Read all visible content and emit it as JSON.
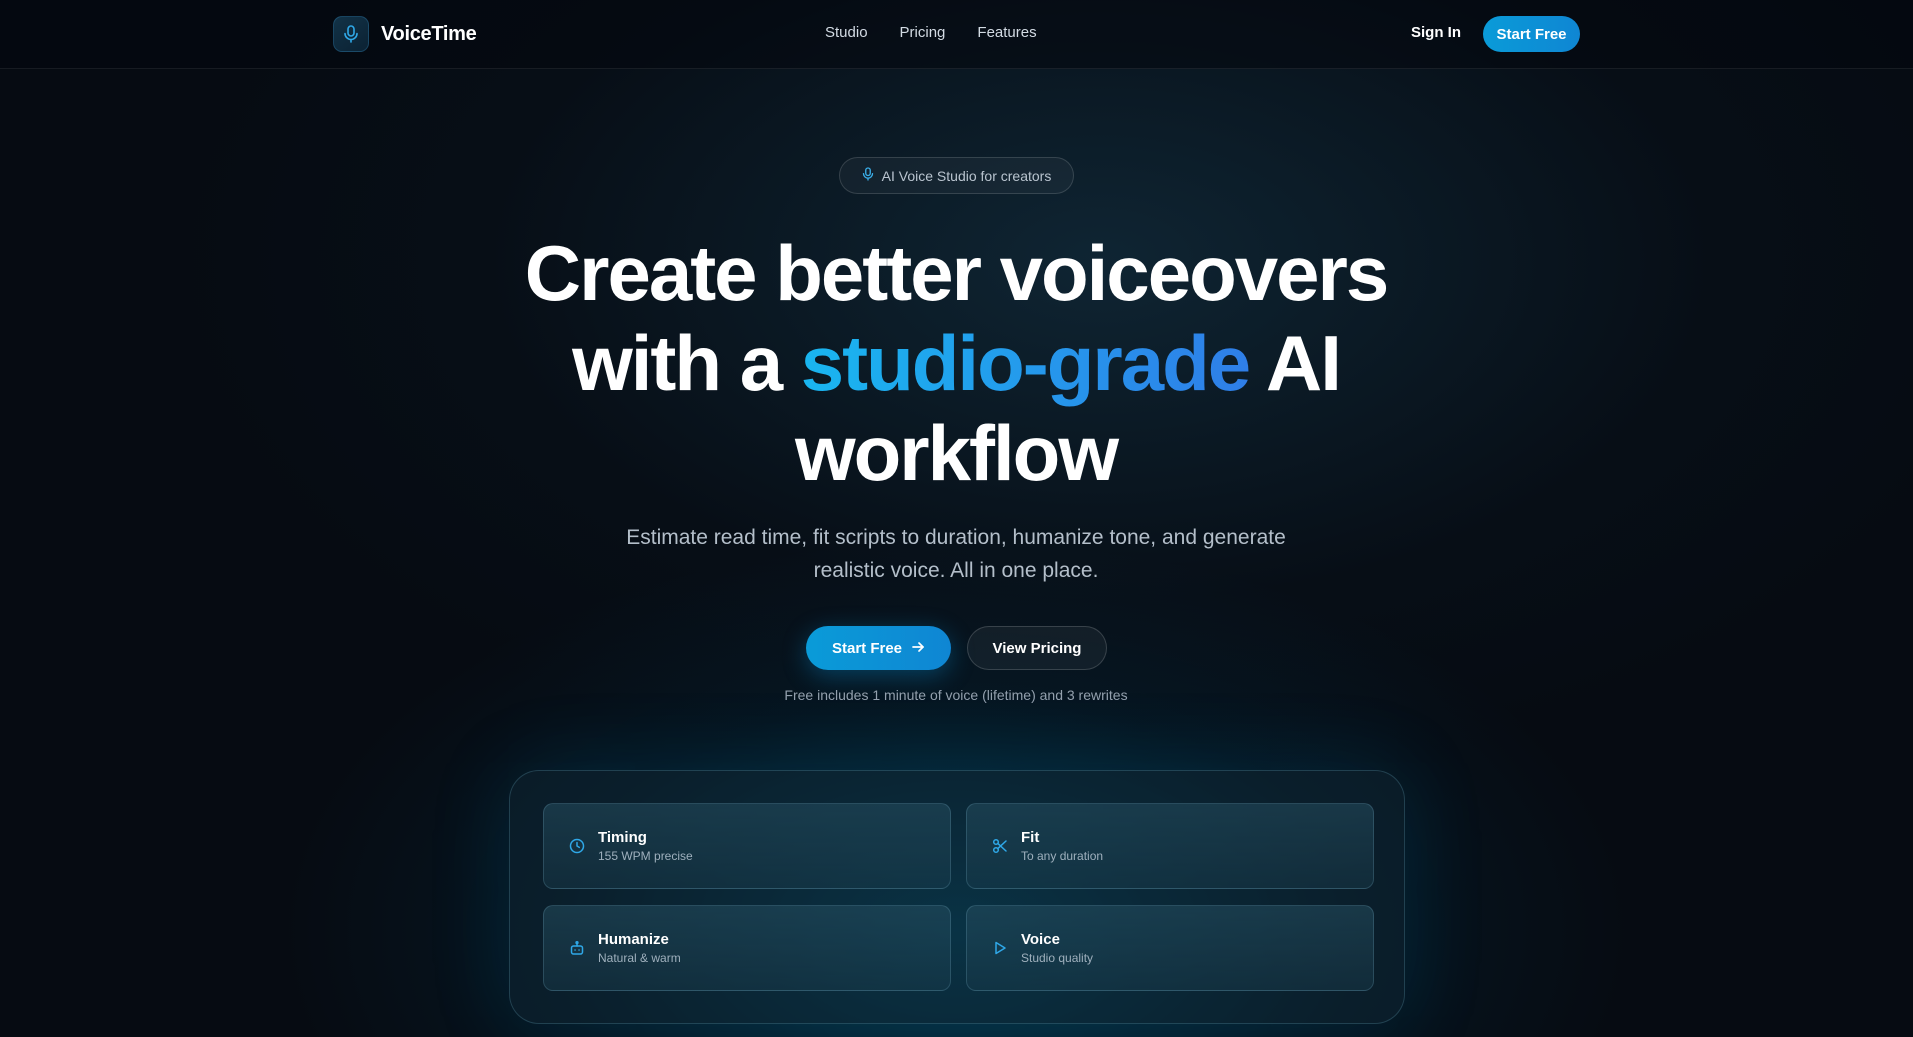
{
  "nav": {
    "brand": "VoiceTime",
    "links": [
      "Studio",
      "Pricing",
      "Features"
    ],
    "sign_in": "Sign In",
    "cta": "Start Free"
  },
  "hero": {
    "badge": "AI Voice Studio for creators",
    "headline_line1": "Create better voiceovers",
    "headline_pre": "with a ",
    "headline_accent": "studio-grade",
    "headline_post": " AI",
    "headline_line3": "workflow",
    "subhead": "Estimate read time, fit scripts to duration, humanize tone, and generate realistic voice. All in one place.",
    "primary_button": "Start Free",
    "secondary_button": "View Pricing",
    "note": "Free includes 1 minute of voice (lifetime) and 3 rewrites"
  },
  "features": [
    {
      "title": "Timing",
      "subtitle": "155 WPM precise",
      "icon": "clock-icon"
    },
    {
      "title": "Fit",
      "subtitle": "To any duration",
      "icon": "scissors-icon"
    },
    {
      "title": "Humanize",
      "subtitle": "Natural & warm",
      "icon": "robot-icon"
    },
    {
      "title": "Voice",
      "subtitle": "Studio quality",
      "icon": "play-icon"
    }
  ],
  "colors": {
    "accent": "#0a9bd8",
    "accent_gradient_end": "#2f7ee8",
    "background": "#060b12"
  }
}
